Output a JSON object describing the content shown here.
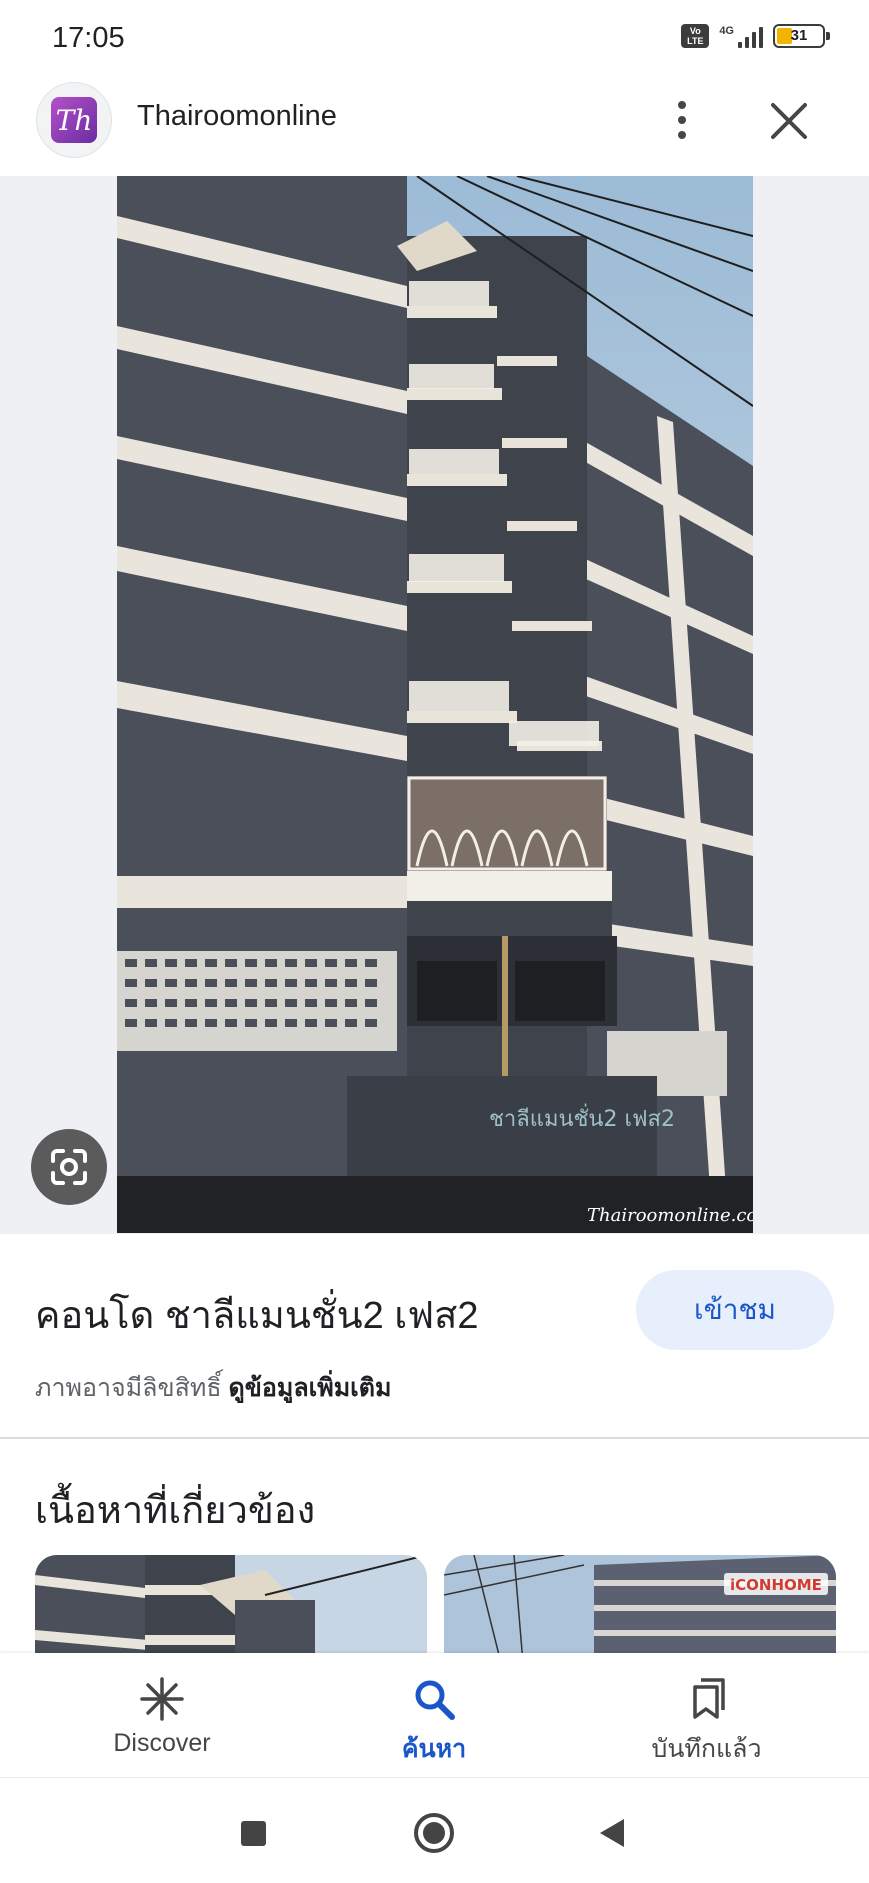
{
  "status_bar": {
    "time": "17:05",
    "volte_label": "Vo\nLTE",
    "network": "4G",
    "battery_level": "31"
  },
  "header": {
    "site_name": "Thairoomonline",
    "logo_text": "Th",
    "more_icon": "more-vert-icon",
    "close_icon": "close-icon"
  },
  "image": {
    "watermark": "Thairoomonline.com",
    "building_sign": "ชาลีแมนชั่น2 เฟส2"
  },
  "lens_icon": "google-lens-icon",
  "info": {
    "title": "คอนโด ชาลีแมนชั่น2 เฟส2",
    "visit_label": "เข้าชม",
    "copyright_text": "ภาพอาจมีลิขสิทธิ์ ",
    "more_info_label": "ดูข้อมูลเพิ่มเติม"
  },
  "related": {
    "heading": "เนื้อหาที่เกี่ยวข้อง",
    "card2_badge": "iCONHOME"
  },
  "bottom_nav": {
    "items": [
      {
        "label": "Discover",
        "icon": "asterisk-icon",
        "active": false
      },
      {
        "label": "ค้นหา",
        "icon": "search-icon",
        "active": true
      },
      {
        "label": "บันทึกแล้ว",
        "icon": "bookmarks-icon",
        "active": false
      }
    ]
  },
  "system_nav": {
    "recents_icon": "square-icon",
    "home_icon": "circle-icon",
    "back_icon": "triangle-back-icon"
  },
  "colors": {
    "accent": "#1a56c9",
    "visit_bg": "#e8effc",
    "building_wall": "#4a4f5a",
    "building_stripe": "#e9e5dc",
    "battery_fill": "#f2b400"
  }
}
